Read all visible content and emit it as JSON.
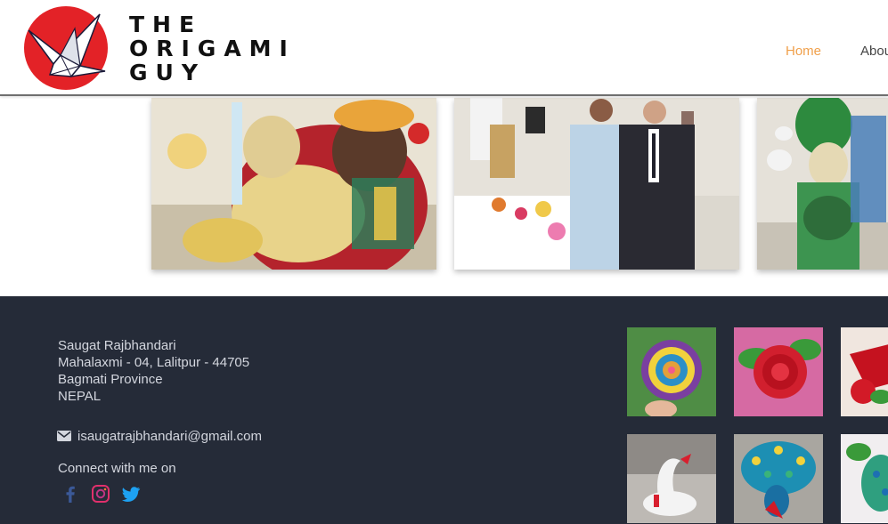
{
  "header": {
    "brand_line1": "THE",
    "brand_line2": "ORIGAMI",
    "brand_line3": "GUY",
    "logo_icon": "paper-crane-logo",
    "nav": {
      "home": "Home",
      "about": "Abou"
    }
  },
  "gallery": {
    "items": [
      {
        "subject": "origami goddess sculpture"
      },
      {
        "subject": "exhibition photo with two men"
      },
      {
        "subject": "origami statue figure"
      }
    ]
  },
  "footer": {
    "address": {
      "name": "Saugat Rajbhandari",
      "line1": "Mahalaxmi - 04, Lalitpur - 44705",
      "line2": "Bagmati Province",
      "country": "NEPAL"
    },
    "email": "isaugatrajbhandari@gmail.com",
    "connect_label": "Connect with me on",
    "social": [
      "facebook-icon",
      "instagram-icon",
      "twitter-icon"
    ]
  },
  "colors": {
    "footer_bg": "#252b38",
    "nav_active": "#f0a04b",
    "logo_red": "#e32227",
    "facebook": "#3b5998",
    "twitter": "#1da1f2"
  }
}
